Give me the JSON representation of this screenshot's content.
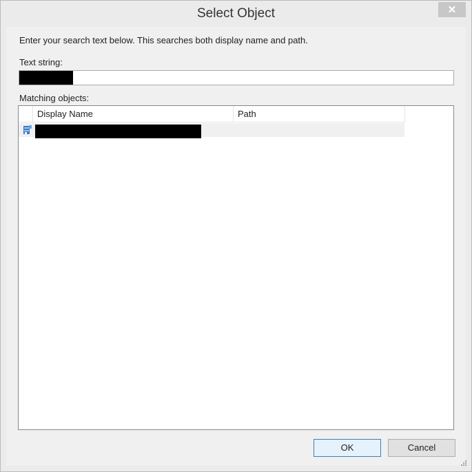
{
  "window": {
    "title": "Select Object",
    "close_icon": "close-icon"
  },
  "instructions": "Enter your search text below. This searches both display name and path.",
  "search": {
    "label": "Text string:",
    "value": ""
  },
  "results": {
    "label": "Matching objects:",
    "columns": [
      "Display Name",
      "Path"
    ],
    "rows": [
      {
        "icon": "object-icon",
        "display_name": "",
        "path": ""
      }
    ]
  },
  "buttons": {
    "ok": "OK",
    "cancel": "Cancel"
  }
}
